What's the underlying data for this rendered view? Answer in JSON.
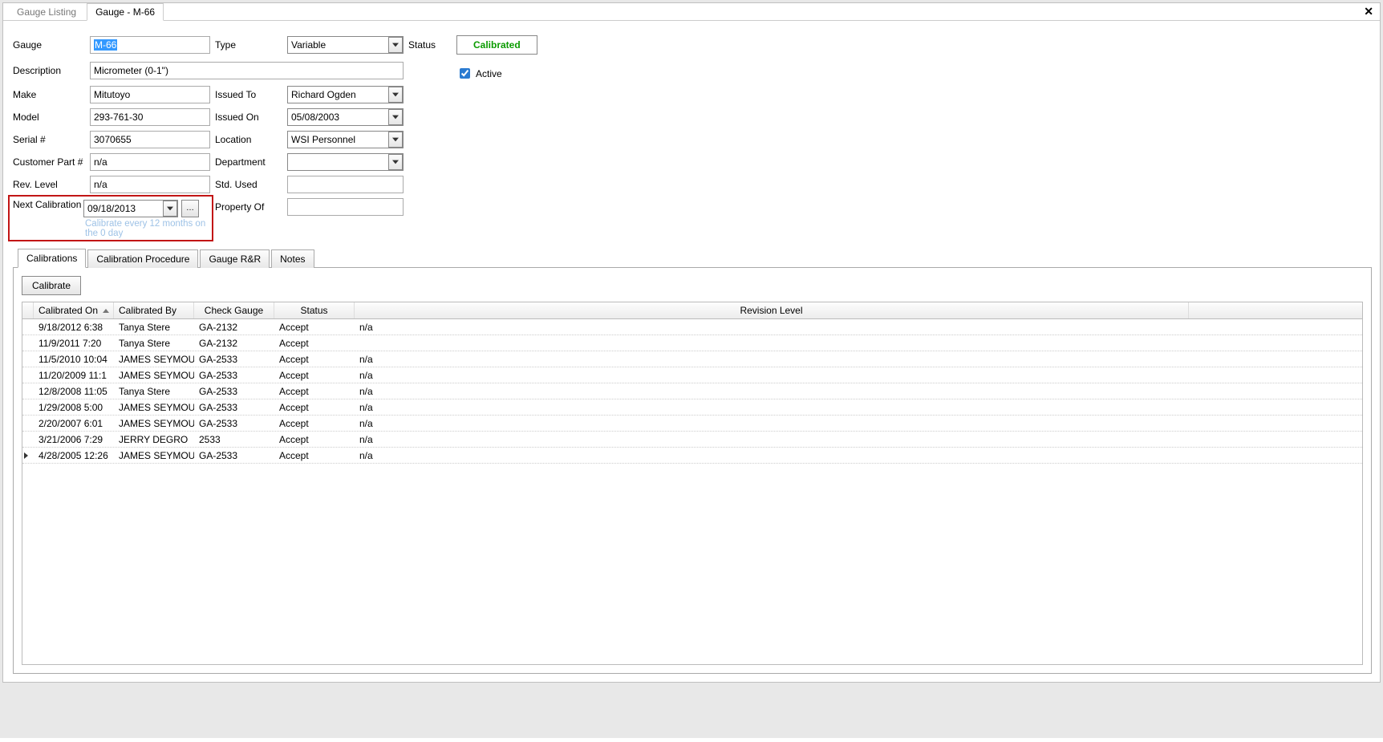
{
  "pageTabs": {
    "listing": "Gauge Listing",
    "detail": "Gauge - M-66"
  },
  "labels": {
    "gauge": "Gauge",
    "type": "Type",
    "status": "Status",
    "description": "Description",
    "active": "Active",
    "make": "Make",
    "issuedTo": "Issued To",
    "model": "Model",
    "issuedOn": "Issued On",
    "serial": "Serial #",
    "location": "Location",
    "custPart": "Customer Part #",
    "department": "Department",
    "revLevel": "Rev. Level",
    "stdUsed": "Std. Used",
    "nextCal": "Next Calibration Due",
    "propertyOf": "Property Of"
  },
  "values": {
    "gauge": "M-66",
    "type": "Variable",
    "statusBadge": "Calibrated",
    "active": true,
    "description": "Micrometer (0-1\")",
    "make": "Mitutoyo",
    "issuedTo": "Richard Ogden",
    "model": "293-761-30",
    "issuedOn": "05/08/2003",
    "serial": "3070655",
    "location": "WSI Personnel",
    "custPart": "n/a",
    "department": "",
    "revLevel": "n/a",
    "stdUsed": "",
    "nextCal": "09/18/2013",
    "propertyOf": "",
    "calHint": "Calibrate every 12 months on the 0 day"
  },
  "subTabs": [
    "Calibrations",
    "Calibration Procedure",
    "Gauge R&R",
    "Notes"
  ],
  "calibrateBtn": "Calibrate",
  "gridCols": [
    "Calibrated On",
    "Calibrated By",
    "Check Gauge",
    "Status",
    "Revision Level"
  ],
  "gridRows": [
    {
      "on": "9/18/2012 6:38",
      "by": "Tanya Stere",
      "gauge": "GA-2132",
      "status": "Accept",
      "rev": "n/a"
    },
    {
      "on": "11/9/2011 7:20",
      "by": "Tanya Stere",
      "gauge": "GA-2132",
      "status": "Accept",
      "rev": ""
    },
    {
      "on": "11/5/2010 10:04",
      "by": "JAMES SEYMOU",
      "gauge": "GA-2533",
      "status": "Accept",
      "rev": "n/a"
    },
    {
      "on": "11/20/2009 11:1",
      "by": "JAMES SEYMOU",
      "gauge": "GA-2533",
      "status": "Accept",
      "rev": "n/a"
    },
    {
      "on": "12/8/2008 11:05",
      "by": "Tanya Stere",
      "gauge": "GA-2533",
      "status": "Accept",
      "rev": "n/a"
    },
    {
      "on": "1/29/2008 5:00",
      "by": "JAMES SEYMOU",
      "gauge": "GA-2533",
      "status": "Accept",
      "rev": "n/a"
    },
    {
      "on": "2/20/2007 6:01",
      "by": "JAMES SEYMOU",
      "gauge": "GA-2533",
      "status": "Accept",
      "rev": "n/a"
    },
    {
      "on": "3/21/2006 7:29",
      "by": "JERRY DEGRO",
      "gauge": "2533",
      "status": "Accept",
      "rev": "n/a"
    },
    {
      "on": "4/28/2005 12:26",
      "by": "JAMES SEYMOU",
      "gauge": "GA-2533",
      "status": "Accept",
      "rev": "n/a"
    }
  ]
}
